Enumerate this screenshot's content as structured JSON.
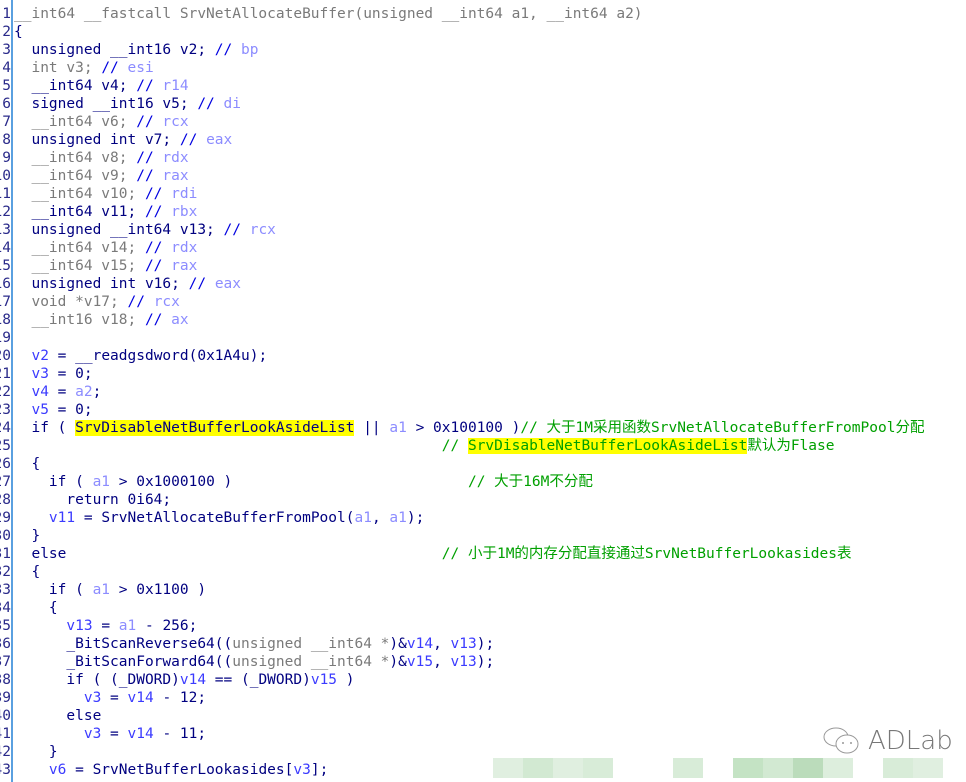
{
  "lines": [
    [
      [
        "__int64 __fastcall SrvNetAllocateBuffer(unsigned __int64 a1, __int64 a2)",
        "g"
      ]
    ],
    [
      [
        "{",
        "k"
      ]
    ],
    [
      [
        "  unsigned __int16 v2; ",
        "k"
      ],
      [
        "// ",
        "s"
      ],
      [
        "bp",
        "r"
      ]
    ],
    [
      [
        "  int v3; ",
        "g"
      ],
      [
        "// ",
        "s"
      ],
      [
        "esi",
        "r"
      ]
    ],
    [
      [
        "  __int64 v4; ",
        "k"
      ],
      [
        "// ",
        "s"
      ],
      [
        "r14",
        "r"
      ]
    ],
    [
      [
        "  signed __int16 v5; ",
        "k"
      ],
      [
        "// ",
        "s"
      ],
      [
        "di",
        "r"
      ]
    ],
    [
      [
        "  __int64 v6; ",
        "g"
      ],
      [
        "// ",
        "s"
      ],
      [
        "rcx",
        "r"
      ]
    ],
    [
      [
        "  unsigned int v7; ",
        "k"
      ],
      [
        "// ",
        "s"
      ],
      [
        "eax",
        "r"
      ]
    ],
    [
      [
        "  __int64 v8; ",
        "g"
      ],
      [
        "// ",
        "s"
      ],
      [
        "rdx",
        "r"
      ]
    ],
    [
      [
        "  __int64 v9; ",
        "g"
      ],
      [
        "// ",
        "s"
      ],
      [
        "rax",
        "r"
      ]
    ],
    [
      [
        "  __int64 v10; ",
        "g"
      ],
      [
        "// ",
        "s"
      ],
      [
        "rdi",
        "r"
      ]
    ],
    [
      [
        "  __int64 v11; ",
        "k"
      ],
      [
        "// ",
        "s"
      ],
      [
        "rbx",
        "r"
      ]
    ],
    [
      [
        "  unsigned __int64 v13; ",
        "k"
      ],
      [
        "// ",
        "s"
      ],
      [
        "rcx",
        "r"
      ]
    ],
    [
      [
        "  __int64 v14; ",
        "g"
      ],
      [
        "// ",
        "s"
      ],
      [
        "rdx",
        "r"
      ]
    ],
    [
      [
        "  __int64 v15; ",
        "g"
      ],
      [
        "// ",
        "s"
      ],
      [
        "rax",
        "r"
      ]
    ],
    [
      [
        "  unsigned int v16; ",
        "k"
      ],
      [
        "// ",
        "s"
      ],
      [
        "eax",
        "r"
      ]
    ],
    [
      [
        "  void *v17; ",
        "g"
      ],
      [
        "// ",
        "s"
      ],
      [
        "rcx",
        "r"
      ]
    ],
    [
      [
        "  __int16 v18; ",
        "g"
      ],
      [
        "// ",
        "s"
      ],
      [
        "ax",
        "r"
      ]
    ],
    [
      [
        "",
        ""
      ]
    ],
    [
      [
        "  ",
        ""
      ],
      [
        "v2",
        "v"
      ],
      [
        " = __readgsdword(0x1A4u);",
        "k"
      ]
    ],
    [
      [
        "  ",
        ""
      ],
      [
        "v3",
        "v"
      ],
      [
        " = 0;",
        "k"
      ]
    ],
    [
      [
        "  ",
        ""
      ],
      [
        "v4",
        "v"
      ],
      [
        " = ",
        "k"
      ],
      [
        "a2",
        "a"
      ],
      [
        ";",
        "k"
      ]
    ],
    [
      [
        "  ",
        ""
      ],
      [
        "v5",
        "v"
      ],
      [
        " = 0;",
        "k"
      ]
    ],
    [
      [
        "  if ( ",
        "k"
      ],
      [
        "SrvDisableNetBufferLookAsideList",
        "hl"
      ],
      [
        " || ",
        "k"
      ],
      [
        "a1",
        "a"
      ],
      [
        " > 0x100100 )",
        "k"
      ],
      [
        "// 大于1M采用函数SrvNetAllocateBufferFromPool分配",
        "c"
      ]
    ],
    [
      [
        "                                                 ",
        ""
      ],
      [
        "// ",
        "c"
      ],
      [
        "SrvDisableNetBufferLookAsideList",
        "hlc"
      ],
      [
        "默认为Flase",
        "c"
      ]
    ],
    [
      [
        "  {",
        "k"
      ]
    ],
    [
      [
        "    if ( ",
        "k"
      ],
      [
        "a1",
        "a"
      ],
      [
        " > 0x1000100 )",
        "k"
      ],
      [
        "                           ",
        ""
      ],
      [
        "// 大于16M不分配",
        "c"
      ]
    ],
    [
      [
        "      return 0i64;",
        "k"
      ]
    ],
    [
      [
        "    ",
        ""
      ],
      [
        "v11",
        "v"
      ],
      [
        " = SrvNetAllocateBufferFromPool(",
        "k"
      ],
      [
        "a1",
        "a"
      ],
      [
        ", ",
        "k"
      ],
      [
        "a1",
        "a"
      ],
      [
        ");",
        "k"
      ]
    ],
    [
      [
        "  }",
        "k"
      ]
    ],
    [
      [
        "  else",
        "k"
      ],
      [
        "                                           ",
        ""
      ],
      [
        "// 小于1M的内存分配直接通过SrvNetBufferLookasides表",
        "c"
      ]
    ],
    [
      [
        "  {",
        "k"
      ]
    ],
    [
      [
        "    if ( ",
        "k"
      ],
      [
        "a1",
        "a"
      ],
      [
        " > 0x1100 )",
        "k"
      ]
    ],
    [
      [
        "    {",
        "k"
      ]
    ],
    [
      [
        "      ",
        ""
      ],
      [
        "v13",
        "v"
      ],
      [
        " = ",
        "k"
      ],
      [
        "a1",
        "a"
      ],
      [
        " - 256;",
        "k"
      ]
    ],
    [
      [
        "      _BitScanReverse64((",
        "k"
      ],
      [
        "unsigned __int64 *",
        "g"
      ],
      [
        ")&",
        "k"
      ],
      [
        "v14",
        "v"
      ],
      [
        ", ",
        "k"
      ],
      [
        "v13",
        "v"
      ],
      [
        ");",
        "k"
      ]
    ],
    [
      [
        "      _BitScanForward64((",
        "k"
      ],
      [
        "unsigned __int64 *",
        "g"
      ],
      [
        ")&",
        "k"
      ],
      [
        "v15",
        "v"
      ],
      [
        ", ",
        "k"
      ],
      [
        "v13",
        "v"
      ],
      [
        ");",
        "k"
      ]
    ],
    [
      [
        "      if ( (_DWORD)",
        "k"
      ],
      [
        "v14",
        "v"
      ],
      [
        " == (_DWORD)",
        "k"
      ],
      [
        "v15",
        "v"
      ],
      [
        " )",
        "k"
      ]
    ],
    [
      [
        "        ",
        ""
      ],
      [
        "v3",
        "v"
      ],
      [
        " = ",
        "k"
      ],
      [
        "v14",
        "v"
      ],
      [
        " - 12;",
        "k"
      ]
    ],
    [
      [
        "      else",
        "k"
      ]
    ],
    [
      [
        "        ",
        ""
      ],
      [
        "v3",
        "v"
      ],
      [
        " = ",
        "k"
      ],
      [
        "v14",
        "v"
      ],
      [
        " - 11;",
        "k"
      ]
    ],
    [
      [
        "    }",
        "k"
      ]
    ],
    [
      [
        "    ",
        ""
      ],
      [
        "v6",
        "v"
      ],
      [
        " = SrvNetBufferLookasides[",
        "k"
      ],
      [
        "v3",
        "v"
      ],
      [
        "];",
        "k"
      ]
    ]
  ],
  "watermark": {
    "text": "ADLab",
    "icon": "wechat-icon"
  },
  "colors": {
    "highlight": "#ffff00",
    "comment": "#00a000",
    "keyword": "#000080"
  }
}
